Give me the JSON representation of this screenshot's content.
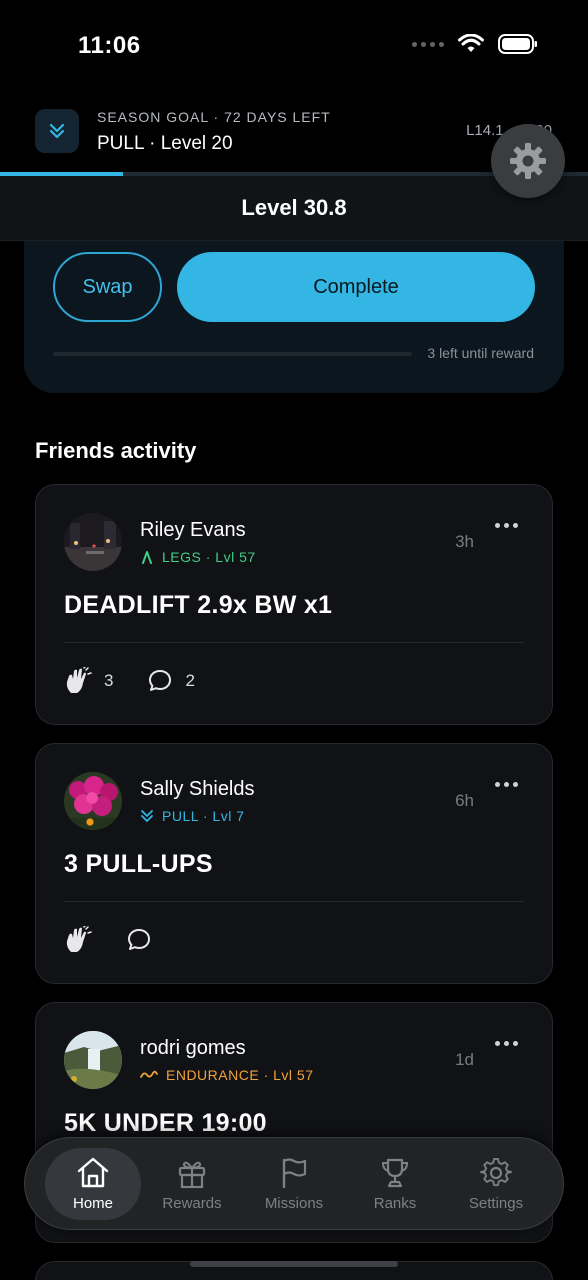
{
  "status_bar": {
    "time": "11:06"
  },
  "season_goal": {
    "subtitle": "SEASON GOAL · 72 DAYS LEFT",
    "title": "PULL · Level 20",
    "level_range": "L14.1 → L20",
    "progress": 0.21
  },
  "level_bar": {
    "label": "Level 30.8"
  },
  "mission": {
    "swap_label": "Swap",
    "complete_label": "Complete",
    "reward_text": "3 left until reward"
  },
  "friends": {
    "heading": "Friends activity",
    "posts": [
      {
        "name": "Riley Evans",
        "tag": "LEGS · Lvl 57",
        "tag_color": "#3fcf86",
        "time": "3h",
        "title": "DEADLIFT 2.9x BW x1",
        "claps": "3",
        "comments": "2"
      },
      {
        "name": "Sally Shields",
        "tag": "PULL · Lvl 7",
        "tag_color": "#33b6e4",
        "time": "6h",
        "title": "3 PULL-UPS",
        "claps": "",
        "comments": ""
      },
      {
        "name": "rodri gomes",
        "tag": "ENDURANCE · Lvl 57",
        "tag_color": "#f0a23a",
        "time": "1d",
        "title": "5K UNDER 19:00"
      }
    ]
  },
  "nav": {
    "items": [
      {
        "label": "Home",
        "icon": "home-icon",
        "active": true
      },
      {
        "label": "Rewards",
        "icon": "gift-icon"
      },
      {
        "label": "Missions",
        "icon": "flag-icon"
      },
      {
        "label": "Ranks",
        "icon": "trophy-icon"
      },
      {
        "label": "Settings",
        "icon": "gear-icon"
      }
    ]
  },
  "colors": {
    "accent": "#33b6e4",
    "background": "#000000",
    "card": "#111215"
  }
}
